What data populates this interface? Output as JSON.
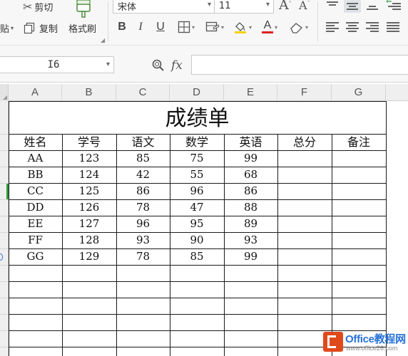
{
  "ribbon": {
    "paste_label": "贴",
    "cut_label": "剪切",
    "copy_label": "复制",
    "format_painter_label": "格式刷",
    "font_name": "宋体",
    "font_size": "11",
    "grow_font_glyph": "A",
    "shrink_font_glyph": "A",
    "bold_glyph": "B",
    "italic_glyph": "I",
    "underline_glyph": "U",
    "font_color_glyph": "A",
    "fill_color": "#f5d000",
    "font_color": "#e02020"
  },
  "formula_bar": {
    "name_box": "I6",
    "fx_label": "fx",
    "formula": ""
  },
  "columns": [
    "A",
    "B",
    "C",
    "D",
    "E",
    "F",
    "G"
  ],
  "sheet": {
    "title": "成绩单",
    "headers": [
      "姓名",
      "学号",
      "语文",
      "数学",
      "英语",
      "总分",
      "备注"
    ],
    "rows": [
      [
        "AA",
        "123",
        "85",
        "75",
        "99",
        "",
        ""
      ],
      [
        "BB",
        "124",
        "42",
        "55",
        "68",
        "",
        ""
      ],
      [
        "CC",
        "125",
        "86",
        "96",
        "86",
        "",
        ""
      ],
      [
        "DD",
        "126",
        "78",
        "47",
        "88",
        "",
        ""
      ],
      [
        "EE",
        "127",
        "96",
        "95",
        "89",
        "",
        ""
      ],
      [
        "FF",
        "128",
        "93",
        "90",
        "93",
        "",
        ""
      ],
      [
        "GG",
        "129",
        "78",
        "85",
        "99",
        "",
        ""
      ]
    ]
  },
  "watermark": {
    "title": "Office教程网",
    "url": "www.office26.com",
    "brand_color": "#e0491b",
    "text_color": "#2673d9"
  }
}
